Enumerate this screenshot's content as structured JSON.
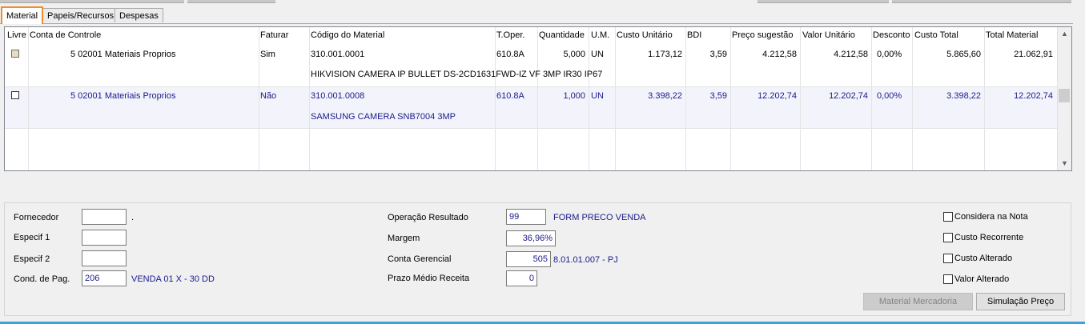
{
  "tabs": [
    "Material",
    "Papeis/Recursos",
    "Despesas"
  ],
  "grid": {
    "headers": [
      "Livre",
      "Conta de Controle",
      "Faturar",
      "Código do Material",
      "T.Oper.",
      "Quantidade",
      "U.M.",
      "Custo Unitário",
      "BDI",
      "Preço sugestão",
      "Valor Unitário",
      "Desconto",
      "Custo Total",
      "Total Material"
    ],
    "rows": [
      {
        "conta": "5 02001 Materiais Proprios",
        "faturar": "Sim",
        "codigo": "310.001.0001",
        "descricao": "HIKVISION CAMERA IP BULLET DS-2CD1631FWD-IZ VF 3MP IR30 IP67",
        "toper": "610.8A",
        "quantidade": "5,000",
        "um": "UN",
        "custo_unitario": "1.173,12",
        "bdi": "3,59",
        "preco_sugestao": "4.212,58",
        "valor_unitario": "4.212,58",
        "desconto": "0,00%",
        "custo_total": "5.865,60",
        "total_material": "21.062,91"
      },
      {
        "conta": "5 02001 Materiais Proprios",
        "faturar": "Não",
        "codigo": "310.001.0008",
        "descricao": "SAMSUNG CAMERA SNB7004 3MP",
        "toper": "610.8A",
        "quantidade": "1,000",
        "um": "UN",
        "custo_unitario": "3.398,22",
        "bdi": "3,59",
        "preco_sugestao": "12.202,74",
        "valor_unitario": "12.202,74",
        "desconto": "0,00%",
        "custo_total": "3.398,22",
        "total_material": "12.202,74"
      }
    ]
  },
  "form": {
    "fornecedor_label": "Fornecedor",
    "fornecedor_value": "",
    "fornecedor_desc": ".",
    "especif1_label": "Especif 1",
    "especif1_value": "",
    "especif2_label": "Especif 2",
    "especif2_value": "",
    "condpag_label": "Cond. de Pag.",
    "condpag_value": "206",
    "condpag_desc": "VENDA 01 X - 30 DD",
    "operacao_label": "Operação Resultado",
    "operacao_value": "99",
    "operacao_desc": "FORM PRECO VENDA",
    "margem_label": "Margem",
    "margem_value": "36,96%",
    "conta_label": "Conta Gerencial",
    "conta_value": "505",
    "conta_desc": "8.01.01.007 - PJ",
    "prazo_label": "Prazo Médio Receita",
    "prazo_value": "0"
  },
  "checkboxes": [
    "Considera na Nota",
    "Custo Recorrente",
    "Custo Alterado",
    "Valor Alterado"
  ],
  "buttons": {
    "material_mercadoria": "Material Mercadoria",
    "simulacao_preco": "Simulação Preço"
  },
  "colors": {
    "active_tab_border": "#f28c28",
    "value_text": "#1a1a8c"
  },
  "icons": [
    "scroll-up-icon",
    "scroll-down-icon"
  ]
}
